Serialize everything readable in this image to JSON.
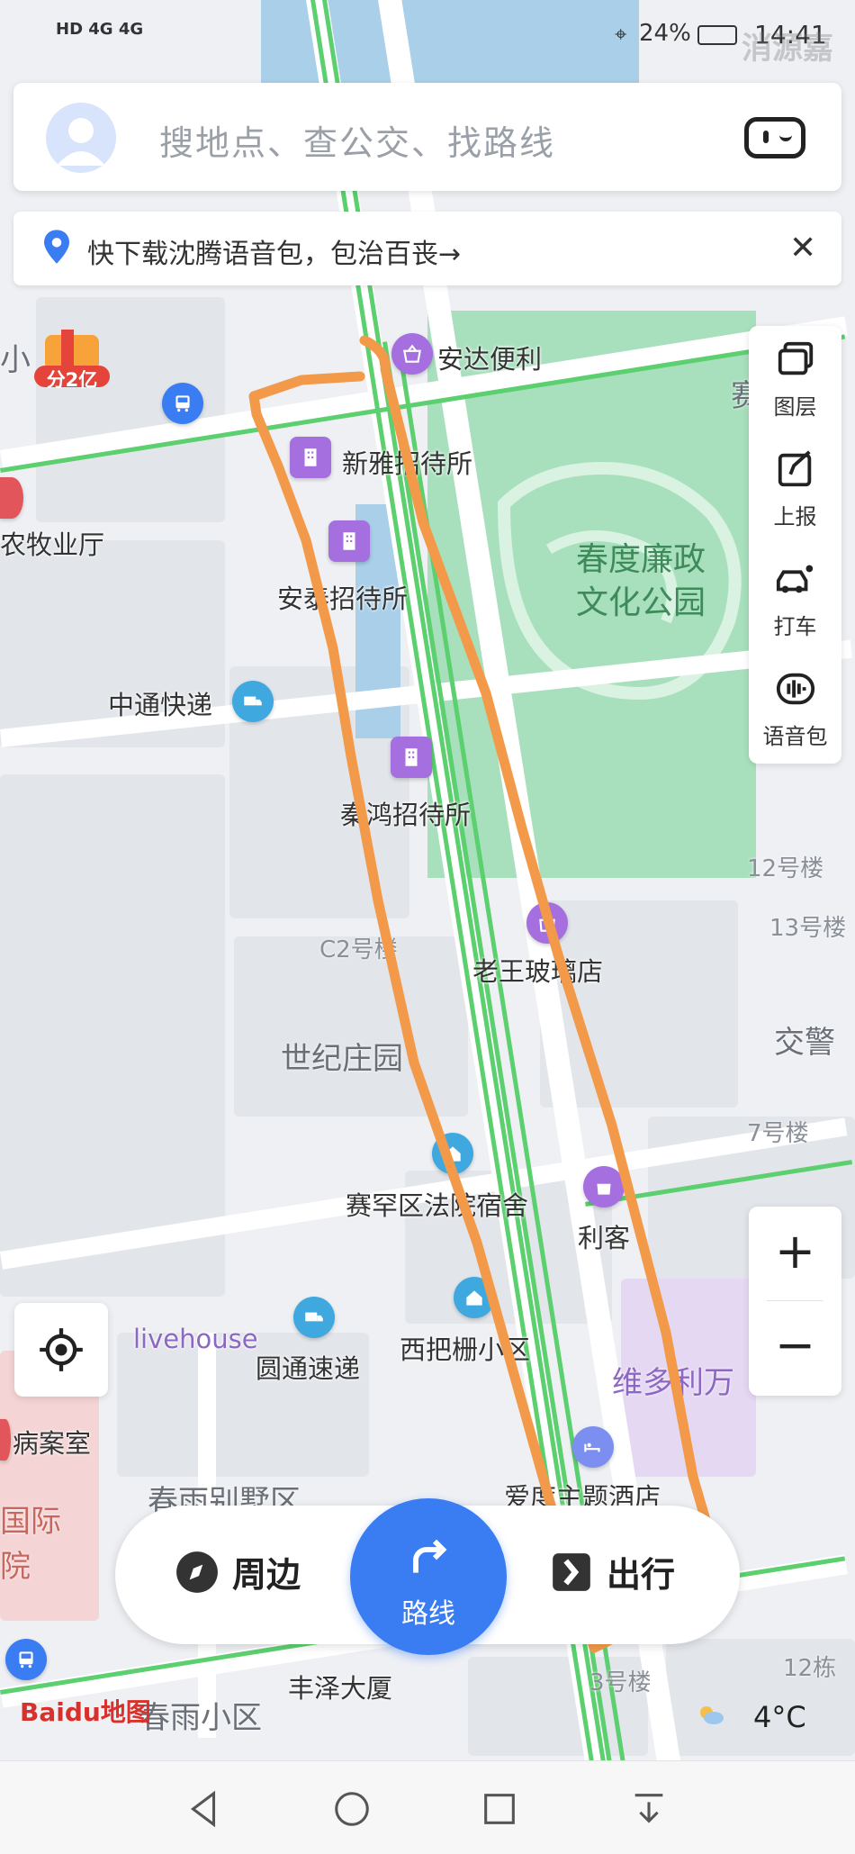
{
  "status_bar": {
    "left": "HD 4G 4G",
    "battery": "24%",
    "time": "14:41",
    "watermark": "消源嘉"
  },
  "search": {
    "placeholder": "搜地点、查公交、找路线"
  },
  "banner": {
    "text": "快下载沈腾语音包，包治百丧→"
  },
  "promo": {
    "badge": "分2亿"
  },
  "side_tools": [
    {
      "label": "图层",
      "icon": "layers-icon"
    },
    {
      "label": "上报",
      "icon": "report-icon"
    },
    {
      "label": "打车",
      "icon": "taxi-icon"
    },
    {
      "label": "语音包",
      "icon": "voice-pack-icon"
    }
  ],
  "map": {
    "pois": [
      {
        "name": "安达便利"
      },
      {
        "name": "新雅招待所"
      },
      {
        "name": "安泰招待所"
      },
      {
        "name": "中通快递"
      },
      {
        "name": "秦鸿招待所"
      },
      {
        "name": "老王玻璃店"
      },
      {
        "name": "赛罕区法院宿舍"
      },
      {
        "name": "利客"
      },
      {
        "name": "西把栅小区"
      },
      {
        "name": "圆通速递"
      },
      {
        "name": "爱度主题酒店"
      },
      {
        "name": "丰泽大厦"
      },
      {
        "name": "农牧业厅"
      },
      {
        "name": "病案室"
      },
      {
        "name": "livehouse"
      }
    ],
    "areas": {
      "park": "春度廉政\n文化公园",
      "century": "世纪庄园",
      "villa": "春雨别墅区",
      "xiaoqu": "春雨小区",
      "jiaojing": "交警",
      "weiduoli": "维多利万",
      "guoji": "国际",
      "yuan": "院",
      "xiao": "小",
      "sai": "赛"
    },
    "buildings": [
      "C2号楼",
      "12号楼",
      "13号楼",
      "7号楼",
      "3号楼",
      "12栋"
    ]
  },
  "zoom": {
    "in": "+",
    "out": "−"
  },
  "bottom_bar": {
    "nearby": "周边",
    "route": "路线",
    "travel": "出行"
  },
  "weather": {
    "temp": "4°C"
  },
  "logo": "Baidu地图",
  "colors": {
    "accent": "#3a7cf2",
    "park": "#a8e0bd",
    "route_line": "#f39a4a",
    "transit_line": "#5ccf6f"
  }
}
